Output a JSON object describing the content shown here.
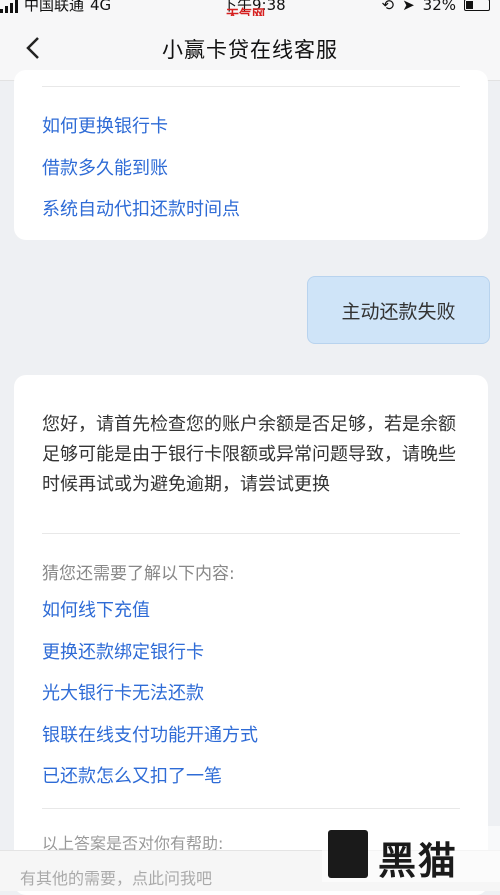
{
  "status_bar": {
    "carrier": "中国联通",
    "network": "4G",
    "time": "下午9:38",
    "watermark": "天气网",
    "battery": "32%"
  },
  "header": {
    "back_icon": "chevron-left-icon",
    "title": "小赢卡贷在线客服"
  },
  "first_card": {
    "links": [
      "如何更换银行卡",
      "借款多久能到账",
      "系统自动代扣还款时间点"
    ]
  },
  "user_message": "主动还款失败",
  "answer_card": {
    "text": "您好，请首先检查您的账户余额是否足够，若是余额足够可能是由于银行卡限额或异常问题导致，请晚些时候再试或为避免逾期，请尝试更换",
    "guess_label": "猜您还需要了解以下内容:",
    "links": [
      "如何线下充值",
      "更换还款绑定银行卡",
      "光大银行卡无法还款",
      "银联在线支付功能开通方式",
      "已还款怎么又扣了一笔"
    ],
    "helpful_prompt": "以上答案是否对你有帮助:"
  },
  "input_bar": {
    "placeholder": "有其他的需要，点此问我吧"
  },
  "logo": {
    "text": "黑猫"
  },
  "colors": {
    "link": "#2e6bd6",
    "user_bubble": "#cfe4f8",
    "watermark": "#d61f1f"
  }
}
